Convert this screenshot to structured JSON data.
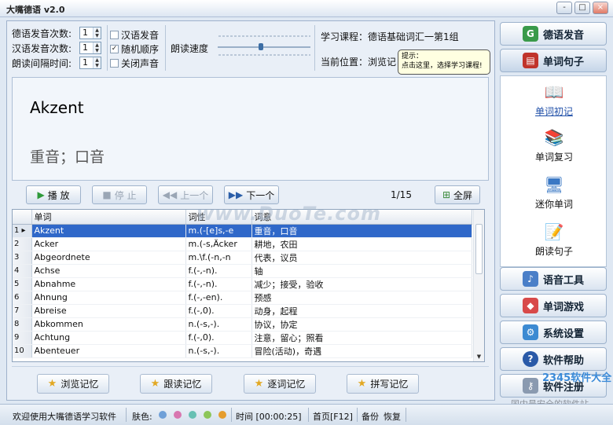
{
  "app": {
    "title": "大嘴德语 v2.0"
  },
  "window_buttons": [
    "-",
    "□",
    "×"
  ],
  "settings": {
    "rows": [
      {
        "label": "德语发音次数:",
        "value": "1"
      },
      {
        "label": "汉语发音次数:",
        "value": "1"
      },
      {
        "label": "朗读间隔时间:",
        "value": "1"
      }
    ],
    "checkboxes": [
      {
        "label": "汉语发音",
        "checked": false
      },
      {
        "label": "随机顺序",
        "checked": true
      },
      {
        "label": "关闭声音",
        "checked": false
      }
    ],
    "speed_label": "朗读速度"
  },
  "course": {
    "label": "学习课程：德语基础词汇一第1组",
    "position_label": "当前位置：浏览记",
    "tooltip_line1": "提示：",
    "tooltip_line2": "点击这里，选择学习课程!"
  },
  "card": {
    "word": "Akzent",
    "meaning": "重音；口音"
  },
  "controls": {
    "play": "播 放",
    "stop": "停 止",
    "prev": "上一个",
    "next": "下一个",
    "counter": "1/15",
    "fullscreen": "全屏"
  },
  "table": {
    "columns": [
      "单词",
      "词性",
      "词意"
    ],
    "selected_row": 1,
    "rows": [
      {
        "n": "1",
        "word": "Akzent",
        "pos": "m.(-[e]s,-e",
        "meaning": "重音，口音"
      },
      {
        "n": "2",
        "word": "Acker",
        "pos": "m.(-s,Äcker",
        "meaning": "耕地，农田"
      },
      {
        "n": "3",
        "word": "Abgeordnete",
        "pos": "m.\\f.(-n,-n",
        "meaning": "代表，议员"
      },
      {
        "n": "4",
        "word": "Achse",
        "pos": "f.(-,-n).",
        "meaning": "轴"
      },
      {
        "n": "5",
        "word": "Abnahme",
        "pos": "f.(-,-n).",
        "meaning": "减少；接受，验收"
      },
      {
        "n": "6",
        "word": "Ahnung",
        "pos": "f.(-,-en).",
        "meaning": "预感"
      },
      {
        "n": "7",
        "word": "Abreise",
        "pos": "f.(-,0).",
        "meaning": "动身，起程"
      },
      {
        "n": "8",
        "word": "Abkommen",
        "pos": "n.(-s,-).",
        "meaning": "协议，协定"
      },
      {
        "n": "9",
        "word": "Achtung",
        "pos": "f.(-,0).",
        "meaning": "注意，留心；照看"
      },
      {
        "n": "10",
        "word": "Abenteuer",
        "pos": "n.(-s,-).",
        "meaning": "冒险(活动)，奇遇"
      }
    ]
  },
  "watermark": "www.DuoTe.com",
  "memory_buttons": [
    "浏览记忆",
    "跟读记忆",
    "逐词记忆",
    "拼写记忆"
  ],
  "sidebar": {
    "buttons_top": [
      "德语发音",
      "单词句子"
    ],
    "subitems": [
      "单词初记",
      "单词复习",
      "迷你单词",
      "朗读句子"
    ],
    "buttons_bottom": [
      "语音工具",
      "单词游戏",
      "系统设置",
      "软件帮助",
      "软件注册"
    ]
  },
  "corner_watermark": {
    "brand": "2345软件大全",
    "slogan": "国内最安全的软件站"
  },
  "statusbar": {
    "welcome": "欢迎使用大嘴德语学习软件",
    "skin_label": "肤色:",
    "skins": [
      "#6fa0d8",
      "#d877b0",
      "#67c0b3",
      "#8cc65a",
      "#e59d2e"
    ],
    "time": "时间 [00:00:25]",
    "home": "首页[F12]",
    "backup": "备份",
    "restore": "恢复"
  }
}
